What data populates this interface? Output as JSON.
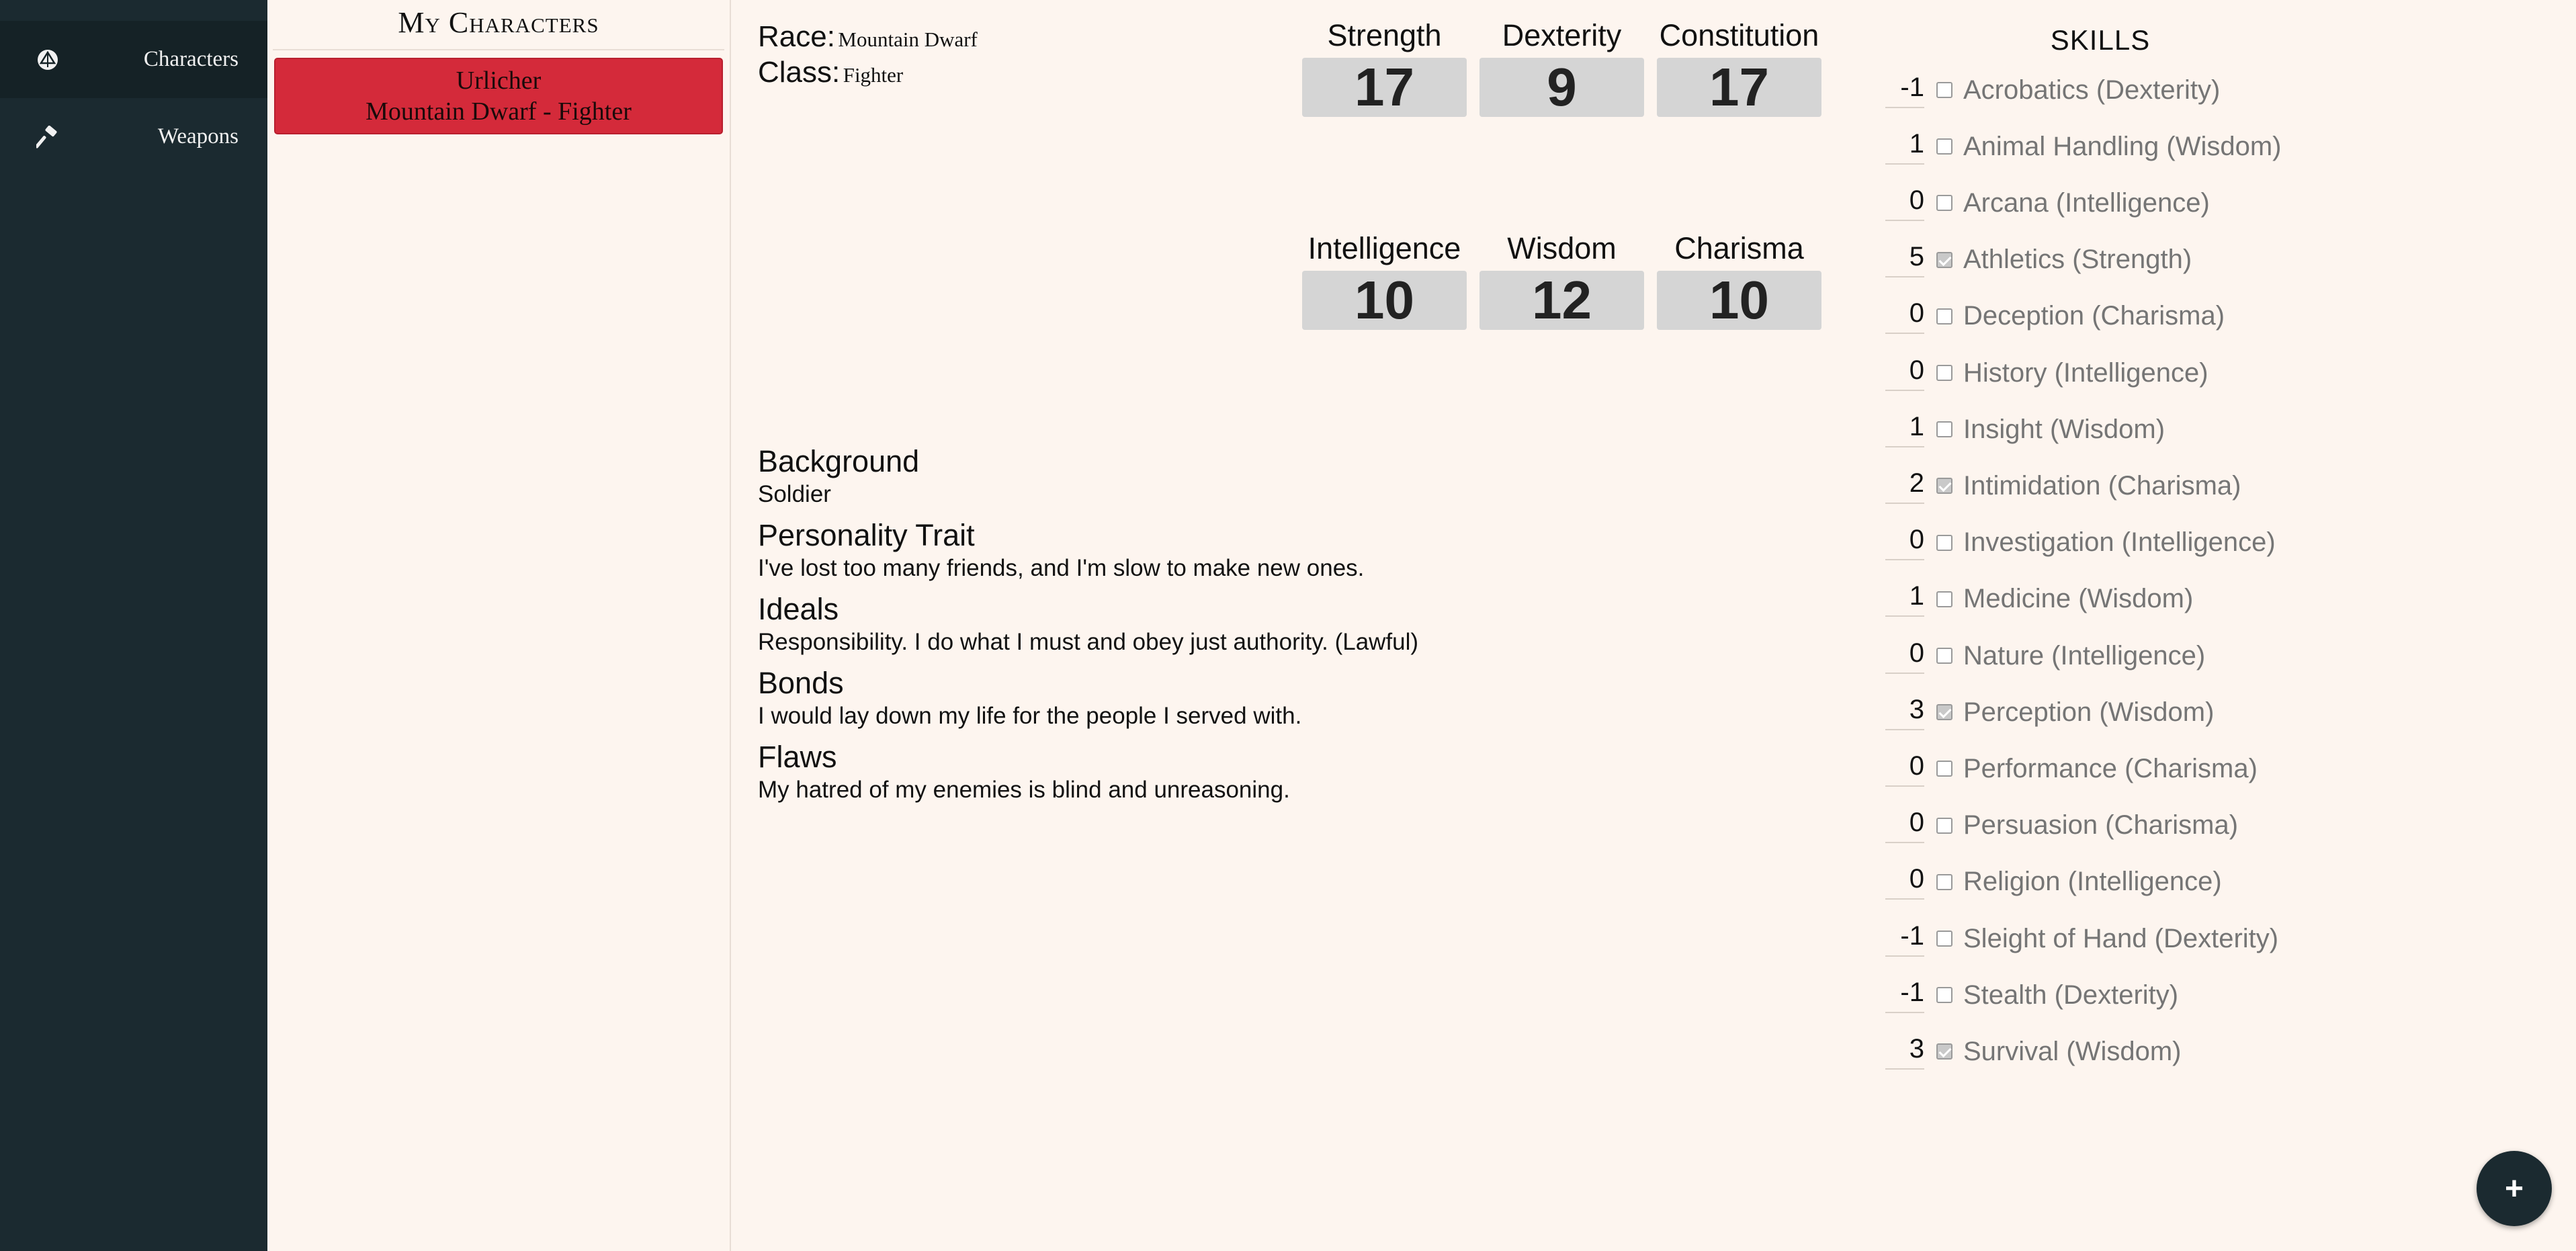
{
  "nav": {
    "items": [
      {
        "label": "Characters",
        "icon": "d20-icon",
        "active": true
      },
      {
        "label": "Weapons",
        "icon": "hammer-icon",
        "active": false
      }
    ]
  },
  "character_list": {
    "title": "My Characters",
    "cards": [
      {
        "name": "Urlicher",
        "subtitle": "Mountain Dwarf - Fighter"
      }
    ]
  },
  "character": {
    "race_label": "Race:",
    "race": "Mountain Dwarf",
    "class_label": "Class:",
    "class": "Fighter"
  },
  "abilities": [
    {
      "name": "Strength",
      "value": "17"
    },
    {
      "name": "Dexterity",
      "value": "9"
    },
    {
      "name": "Constitution",
      "value": "17"
    },
    {
      "name": "Intelligence",
      "value": "10"
    },
    {
      "name": "Wisdom",
      "value": "12"
    },
    {
      "name": "Charisma",
      "value": "10"
    }
  ],
  "bio": [
    {
      "title": "Background",
      "text": "Soldier"
    },
    {
      "title": "Personality Trait",
      "text": "I've lost too many friends, and I'm slow to make new ones."
    },
    {
      "title": "Ideals",
      "text": "Responsibility. I do what I must and obey just authority. (Lawful)"
    },
    {
      "title": "Bonds",
      "text": "I would lay down my life for the people I served with."
    },
    {
      "title": "Flaws",
      "text": "My hatred of my enemies is blind and unreasoning."
    }
  ],
  "skills": {
    "title": "SKILLS",
    "items": [
      {
        "mod": "-1",
        "name": "Acrobatics (Dexterity)",
        "proficient": false
      },
      {
        "mod": "1",
        "name": "Animal Handling (Wisdom)",
        "proficient": false
      },
      {
        "mod": "0",
        "name": "Arcana (Intelligence)",
        "proficient": false
      },
      {
        "mod": "5",
        "name": "Athletics (Strength)",
        "proficient": true
      },
      {
        "mod": "0",
        "name": "Deception (Charisma)",
        "proficient": false
      },
      {
        "mod": "0",
        "name": "History (Intelligence)",
        "proficient": false
      },
      {
        "mod": "1",
        "name": "Insight (Wisdom)",
        "proficient": false
      },
      {
        "mod": "2",
        "name": "Intimidation (Charisma)",
        "proficient": true
      },
      {
        "mod": "0",
        "name": "Investigation (Intelligence)",
        "proficient": false
      },
      {
        "mod": "1",
        "name": "Medicine (Wisdom)",
        "proficient": false
      },
      {
        "mod": "0",
        "name": "Nature (Intelligence)",
        "proficient": false
      },
      {
        "mod": "3",
        "name": "Perception (Wisdom)",
        "proficient": true
      },
      {
        "mod": "0",
        "name": "Performance (Charisma)",
        "proficient": false
      },
      {
        "mod": "0",
        "name": "Persuasion (Charisma)",
        "proficient": false
      },
      {
        "mod": "0",
        "name": "Religion (Intelligence)",
        "proficient": false
      },
      {
        "mod": "-1",
        "name": "Sleight of Hand (Dexterity)",
        "proficient": false
      },
      {
        "mod": "-1",
        "name": "Stealth (Dexterity)",
        "proficient": false
      },
      {
        "mod": "3",
        "name": "Survival (Wisdom)",
        "proficient": true
      }
    ]
  },
  "fab": {
    "label": "+",
    "icon": "plus-icon"
  }
}
